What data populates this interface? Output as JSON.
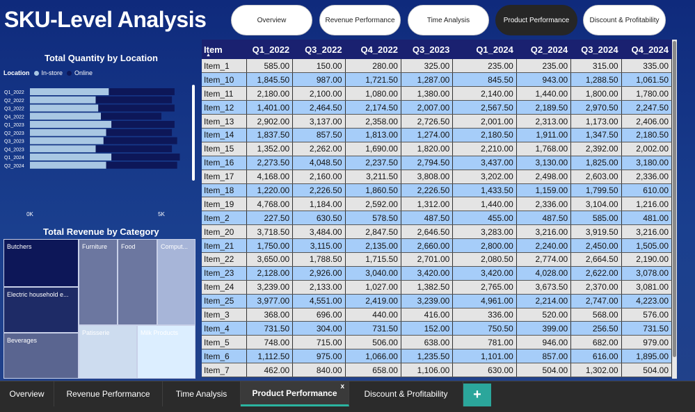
{
  "title": "SKU-Level Analysis",
  "nav": {
    "buttons": [
      "Overview",
      "Revenue Performance",
      "Time Analysis",
      "Product Performance",
      "Discount & Profitability"
    ],
    "active_index": 3
  },
  "qty_chart": {
    "title": "Total Quantity by Location",
    "legend_label": "Location",
    "series_names": [
      "In-store",
      "Online"
    ],
    "colors": {
      "in_store": "#a9c7e3",
      "online": "#0d1758"
    },
    "x_ticks": [
      "0K",
      "5K"
    ]
  },
  "chart_data": {
    "type": "bar",
    "orientation": "horizontal",
    "stacked": true,
    "title": "Total Quantity by Location",
    "categories": [
      "Q1_2022",
      "Q2_2022",
      "Q3_2022",
      "Q4_2022",
      "Q1_2023",
      "Q2_2023",
      "Q3_2023",
      "Q4_2023",
      "Q1_2024",
      "Q2_2024"
    ],
    "series": [
      {
        "name": "In-store",
        "values": [
          3000,
          2500,
          2600,
          2700,
          3100,
          2900,
          2800,
          2500,
          3100,
          2900
        ]
      },
      {
        "name": "Online",
        "values": [
          2500,
          2900,
          2900,
          2300,
          2400,
          2500,
          2800,
          2900,
          2600,
          2700
        ]
      }
    ],
    "xlim": [
      0,
      7000
    ],
    "x_ticks": [
      "0K",
      "5K"
    ]
  },
  "revenue_treemap": {
    "title": "Total Revenue by Category",
    "tiles": [
      {
        "label": "Butchers",
        "color": "#0d1758"
      },
      {
        "label": "Electric household e...",
        "color": "#1e2b66"
      },
      {
        "label": "Beverages",
        "color": "#5a6590"
      },
      {
        "label": "Furniture",
        "color": "#6c77a0"
      },
      {
        "label": "Food",
        "color": "#6c77a0"
      },
      {
        "label": "Comput...",
        "color": "#a7b5d8"
      },
      {
        "label": "Patisserie",
        "color": "#cddcef"
      },
      {
        "label": "Milk Products",
        "color": "#dceeff"
      }
    ]
  },
  "table": {
    "columns": [
      "Item",
      "Q1_2022",
      "Q3_2022",
      "Q4_2022",
      "Q3_2023",
      "Q1_2024",
      "Q2_2024",
      "Q3_2024",
      "Q4_2024"
    ],
    "rows": [
      [
        "Item_1",
        "585.00",
        "150.00",
        "280.00",
        "325.00",
        "235.00",
        "235.00",
        "315.00",
        "335.00"
      ],
      [
        "Item_10",
        "1,845.50",
        "987.00",
        "1,721.50",
        "1,287.00",
        "845.50",
        "943.00",
        "1,288.50",
        "1,061.50"
      ],
      [
        "Item_11",
        "2,180.00",
        "2,100.00",
        "1,080.00",
        "1,380.00",
        "2,140.00",
        "1,440.00",
        "1,800.00",
        "1,780.00"
      ],
      [
        "Item_12",
        "1,401.00",
        "2,464.50",
        "2,174.50",
        "2,007.00",
        "2,567.50",
        "2,189.50",
        "2,970.50",
        "2,247.50"
      ],
      [
        "Item_13",
        "2,902.00",
        "3,137.00",
        "2,358.00",
        "2,726.50",
        "2,001.00",
        "2,313.00",
        "1,173.00",
        "2,406.00"
      ],
      [
        "Item_14",
        "1,837.50",
        "857.50",
        "1,813.00",
        "1,274.00",
        "2,180.50",
        "1,911.00",
        "1,347.50",
        "2,180.50"
      ],
      [
        "Item_15",
        "1,352.00",
        "2,262.00",
        "1,690.00",
        "1,820.00",
        "2,210.00",
        "1,768.00",
        "2,392.00",
        "2,002.00"
      ],
      [
        "Item_16",
        "2,273.50",
        "4,048.50",
        "2,237.50",
        "2,794.50",
        "3,437.00",
        "3,130.00",
        "1,825.00",
        "3,180.00"
      ],
      [
        "Item_17",
        "4,168.00",
        "2,160.00",
        "3,211.50",
        "3,808.00",
        "3,202.00",
        "2,498.00",
        "2,603.00",
        "2,336.00"
      ],
      [
        "Item_18",
        "1,220.00",
        "2,226.50",
        "1,860.50",
        "2,226.50",
        "1,433.50",
        "1,159.00",
        "1,799.50",
        "610.00"
      ],
      [
        "Item_19",
        "4,768.00",
        "1,184.00",
        "2,592.00",
        "1,312.00",
        "1,440.00",
        "2,336.00",
        "3,104.00",
        "1,216.00"
      ],
      [
        "Item_2",
        "227.50",
        "630.50",
        "578.50",
        "487.50",
        "455.00",
        "487.50",
        "585.00",
        "481.00"
      ],
      [
        "Item_20",
        "3,718.50",
        "3,484.00",
        "2,847.50",
        "2,646.50",
        "3,283.00",
        "3,216.00",
        "3,919.50",
        "3,216.00"
      ],
      [
        "Item_21",
        "1,750.00",
        "3,115.00",
        "2,135.00",
        "2,660.00",
        "2,800.00",
        "2,240.00",
        "2,450.00",
        "1,505.00"
      ],
      [
        "Item_22",
        "3,650.00",
        "1,788.50",
        "1,715.50",
        "2,701.00",
        "2,080.50",
        "2,774.00",
        "2,664.50",
        "2,190.00"
      ],
      [
        "Item_23",
        "2,128.00",
        "2,926.00",
        "3,040.00",
        "3,420.00",
        "3,420.00",
        "4,028.00",
        "2,622.00",
        "3,078.00"
      ],
      [
        "Item_24",
        "3,239.00",
        "2,133.00",
        "1,027.00",
        "1,382.50",
        "2,765.00",
        "3,673.50",
        "2,370.00",
        "3,081.00"
      ],
      [
        "Item_25",
        "3,977.00",
        "4,551.00",
        "2,419.00",
        "3,239.00",
        "4,961.00",
        "2,214.00",
        "2,747.00",
        "4,223.00"
      ],
      [
        "Item_3",
        "368.00",
        "696.00",
        "440.00",
        "416.00",
        "336.00",
        "520.00",
        "568.00",
        "576.00"
      ],
      [
        "Item_4",
        "731.50",
        "304.00",
        "731.50",
        "152.00",
        "750.50",
        "399.00",
        "256.50",
        "731.50"
      ],
      [
        "Item_5",
        "748.00",
        "715.00",
        "506.00",
        "638.00",
        "781.00",
        "946.00",
        "682.00",
        "979.00"
      ],
      [
        "Item_6",
        "1,112.50",
        "975.00",
        "1,066.00",
        "1,235.50",
        "1,101.00",
        "857.00",
        "616.00",
        "1,895.00"
      ],
      [
        "Item_7",
        "462.00",
        "840.00",
        "658.00",
        "1,106.00",
        "630.00",
        "504.00",
        "1,302.00",
        "504.00"
      ]
    ]
  },
  "tabs": {
    "items": [
      "Overview",
      "Revenue Performance",
      "Time Analysis",
      "Product Performance",
      "Discount & Profitability"
    ],
    "active_index": 3,
    "close_glyph": "x",
    "add_glyph": "+"
  }
}
